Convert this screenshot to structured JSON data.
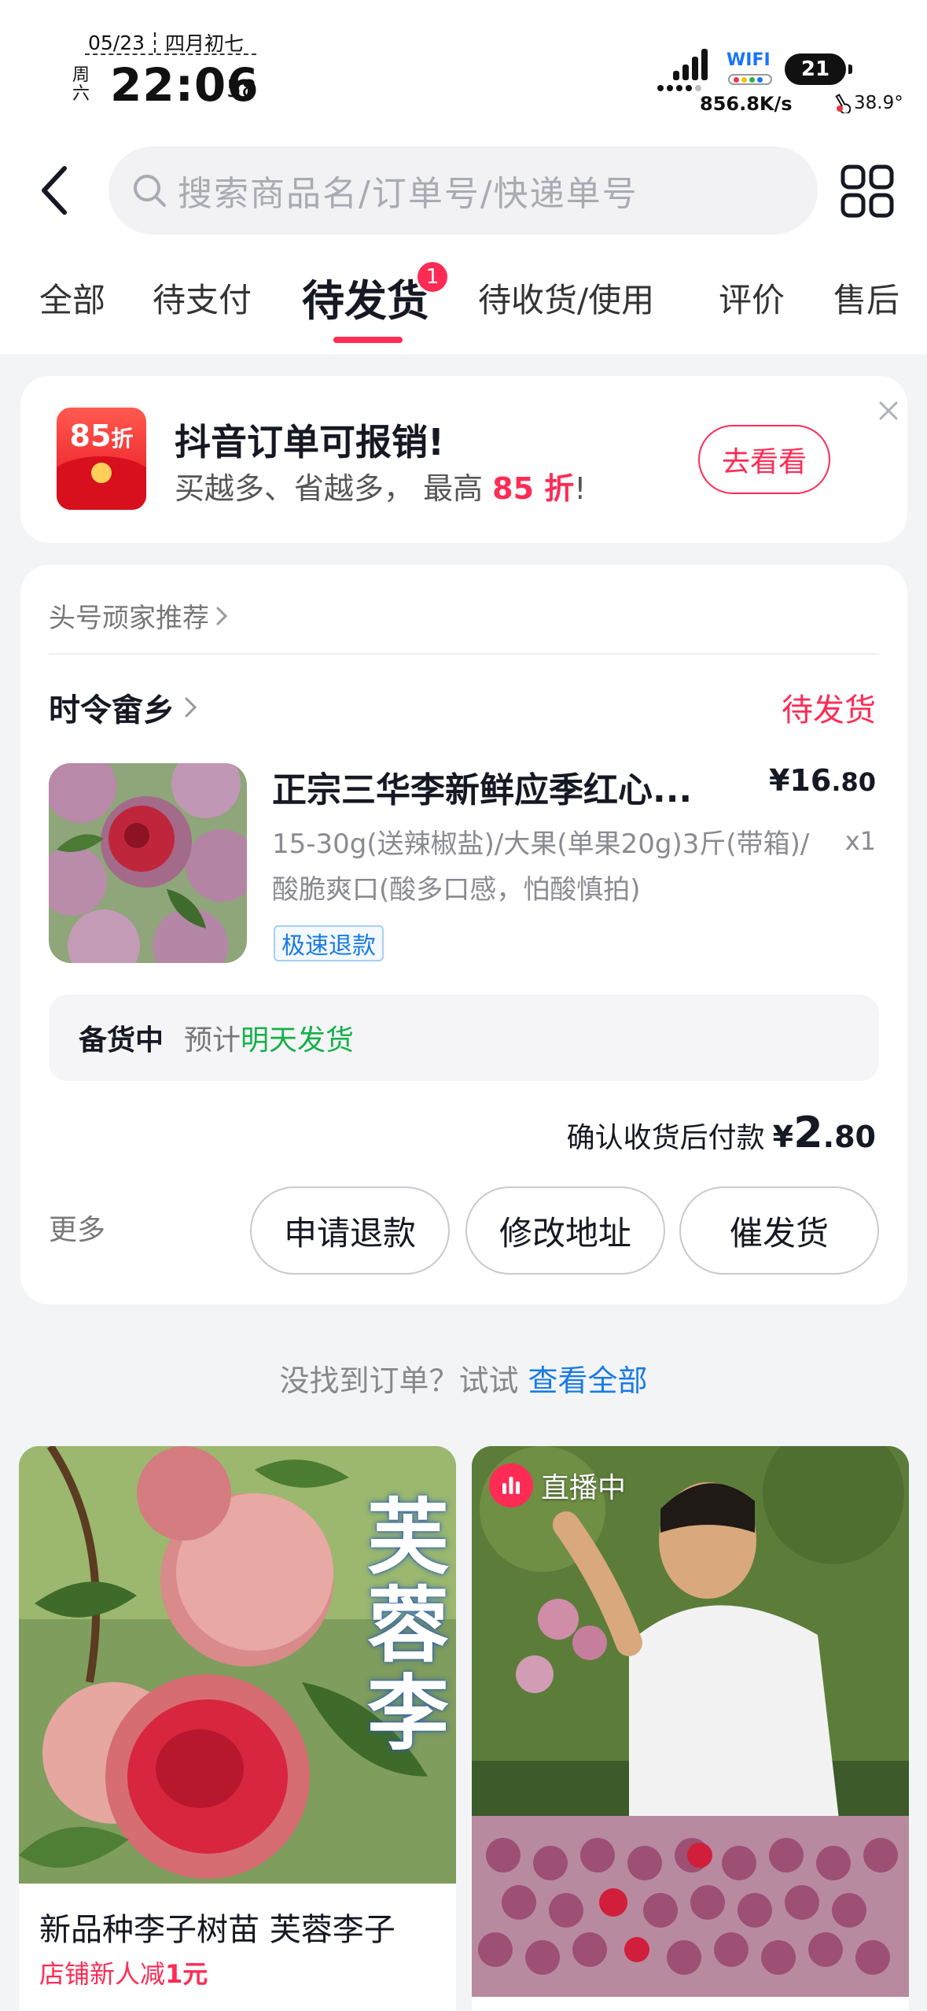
{
  "status_bar": {
    "date": "05/23",
    "lunar": "四月初七",
    "weekday": "周六",
    "time": "22:06",
    "seconds": "58",
    "wifi_label": "WIFI",
    "battery": "21",
    "net_speed": "856.8K/s",
    "temperature": "38.9°"
  },
  "header": {
    "search_placeholder": "搜索商品名/订单号/快递单号"
  },
  "tabs": [
    {
      "label": "全部"
    },
    {
      "label": "待支付"
    },
    {
      "label": "待发货",
      "active": true,
      "badge": "1"
    },
    {
      "label": "待收货/使用"
    },
    {
      "label": "评价"
    },
    {
      "label": "售后"
    }
  ],
  "promo": {
    "icon_text": "85",
    "icon_unit": "折",
    "title": "抖音订单可报销!",
    "subtitle_prefix": "买越多、省越多， 最高 ",
    "subtitle_highlight": "85 折",
    "subtitle_suffix": "!",
    "button": "去看看"
  },
  "order": {
    "recommend_label": "头号顽家推荐",
    "shop_name": "时令畲乡",
    "status": "待发货",
    "product_title": "正宗三华李新鲜应季红心...",
    "price_symbol": "¥",
    "price_int": "16",
    "price_dec": ".80",
    "spec": "15-30g(送辣椒盐)/大果(单果20g)3斤(带箱)/酸脆爽口(酸多口感，怕酸慎拍)",
    "quantity": "x1",
    "tag": "极速退款",
    "stock_status": "备货中",
    "eta_prefix": "预计",
    "eta_value": "明天发货",
    "pay_label": "确认收货后付款",
    "pay_symbol": "¥",
    "pay_int": "2",
    "pay_dec": ".80",
    "more": "更多",
    "actions": [
      "申请退款",
      "修改地址",
      "催发货"
    ]
  },
  "not_found": {
    "text": "没找到订单？试试 ",
    "link": "查看全部"
  },
  "recommend": [
    {
      "image_text": "芙蓉李",
      "title": "新品种李子树苗 芙蓉李子",
      "promo_prefix": "店铺新人减",
      "promo_value": "1元"
    },
    {
      "live_label": "直播中"
    }
  ],
  "colors": {
    "accent": "#fe2c55",
    "link": "#1a7be6",
    "success": "#16b04a",
    "background": "#f3f4f6"
  }
}
